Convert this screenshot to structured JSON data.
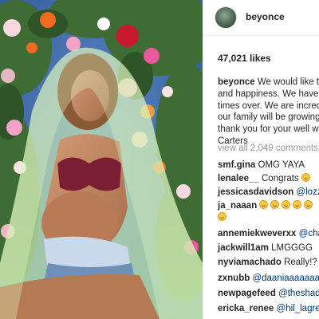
{
  "post": {
    "username": "beyonce",
    "likes": "47,021 likes",
    "caption": {
      "username": "beyonce",
      "lines": [
        "We would like to",
        "and happiness. We have b",
        "times over. We are incredi",
        "our family will be growing",
        "thank you for your well wis",
        "Carters"
      ]
    },
    "view_all": "view all 2,049 comments"
  },
  "comments": [
    {
      "user": "smf.gina",
      "text": "OMG YAYA",
      "mention": "",
      "emoji_count": 0
    },
    {
      "user": "lenalee__",
      "text": "Congrats",
      "mention": "",
      "emoji_count": 1
    },
    {
      "user": "jessicasdavidson",
      "text": "",
      "mention": "@lozzan",
      "emoji_count": 0
    },
    {
      "user": "ja_naaan",
      "text": "",
      "mention": "",
      "emoji_count": 5
    },
    {
      "user": "",
      "text": "",
      "mention": "",
      "emoji_count": 1
    },
    {
      "user": "annemiekweverxx",
      "text": "",
      "mention": "@chans",
      "emoji_count": 0
    },
    {
      "user": "jackwill1am",
      "text": "LMGGGG",
      "mention": "",
      "emoji_count": 0
    },
    {
      "user": "nyviamachado",
      "text": "Really!?",
      "mention": "",
      "emoji_count": 0
    },
    {
      "user": "zxnubb",
      "text": "",
      "mention": "@daaniaaaaaaa",
      "emoji_count": 0
    },
    {
      "user": "newpagefeed",
      "text": "",
      "mention": "@theshade",
      "emoji_count": 0
    },
    {
      "user": "ericka_renee",
      "text": "",
      "mention": "@hil_lagrea",
      "emoji_count": 0
    }
  ],
  "colors": {
    "background": "#ffffff",
    "text": "#262626",
    "muted": "#999999",
    "mention": "#003569",
    "border": "#efefef",
    "photo_sky": "#3f6aa8"
  }
}
